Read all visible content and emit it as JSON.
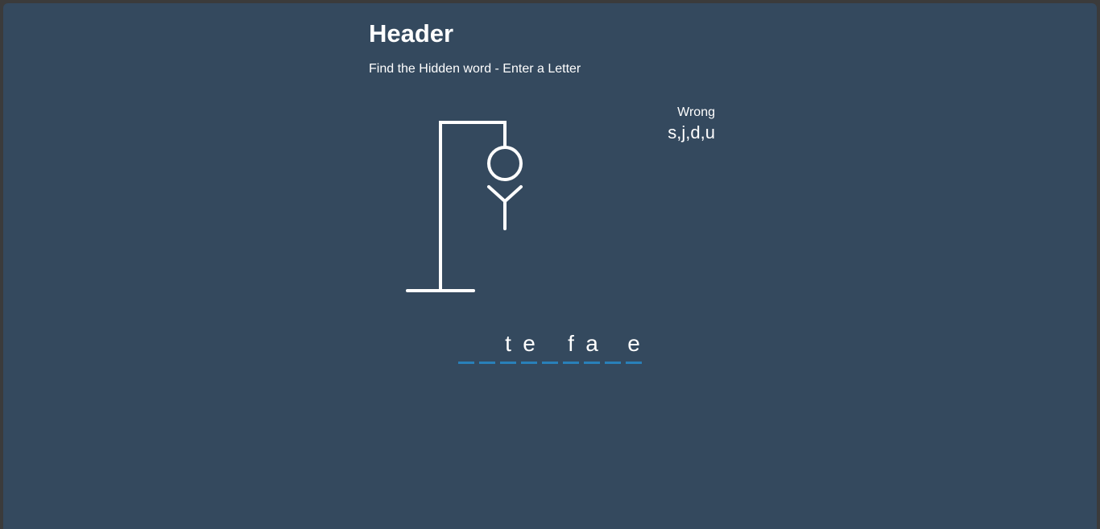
{
  "header": {
    "title": "Header",
    "subtitle": "Find the Hidden word - Enter a Letter"
  },
  "wrong": {
    "label": "Wrong",
    "letters": "s,j,d,u"
  },
  "word": {
    "letters": [
      "",
      "",
      "t",
      "e",
      "",
      "f",
      "a",
      "",
      "e"
    ]
  },
  "hangman": {
    "parts_shown": [
      "head",
      "body",
      "left-arm",
      "right-arm"
    ]
  },
  "colors": {
    "background": "#34495e",
    "accent": "#2980b9",
    "text": "#ffffff"
  }
}
